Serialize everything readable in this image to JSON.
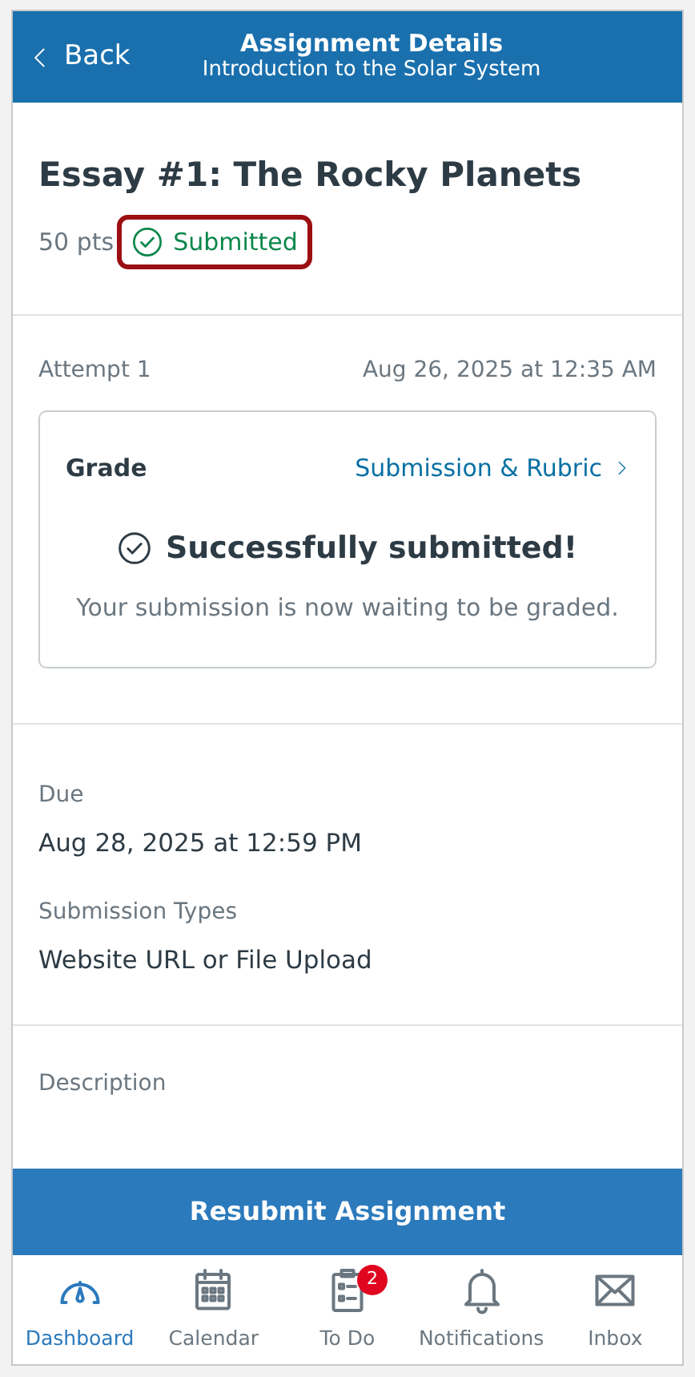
{
  "header": {
    "back_label": "Back",
    "title": "Assignment Details",
    "subtitle": "Introduction to the Solar System"
  },
  "assignment": {
    "title": "Essay #1: The Rocky Planets",
    "points": "50 pts",
    "status": "Submitted",
    "status_highlighted": true
  },
  "attempt": {
    "label": "Attempt 1",
    "date": "Aug 26, 2025 at 12:35 AM"
  },
  "grade_card": {
    "label": "Grade",
    "link": "Submission & Rubric",
    "message": "Successfully submitted!",
    "detail": "Your submission is now waiting to be graded."
  },
  "details": [
    {
      "label": "Due",
      "value": "Aug 28, 2025 at 12:59 PM"
    },
    {
      "label": "Submission Types",
      "value": "Website URL or File Upload"
    }
  ],
  "description": {
    "label": "Description"
  },
  "action_button": "Resubmit Assignment",
  "tab_bar": [
    {
      "kind": "dashboard",
      "label": "Dashboard",
      "selected": true
    },
    {
      "kind": "calendar",
      "label": "Calendar",
      "selected": false
    },
    {
      "kind": "todo",
      "label": "To Do",
      "selected": false,
      "badge": "2"
    },
    {
      "kind": "notifications",
      "label": "Notifications",
      "selected": false
    },
    {
      "kind": "inbox",
      "label": "Inbox",
      "selected": false
    }
  ]
}
